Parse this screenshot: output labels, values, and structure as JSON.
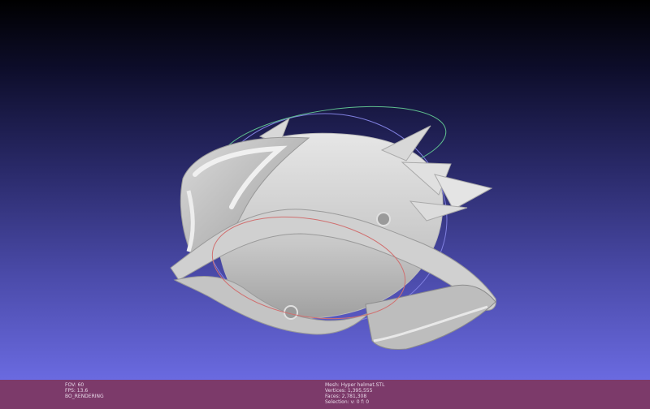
{
  "viewer": {
    "model_name": "helmet mesh"
  },
  "status": {
    "left": [
      "FOV: 60",
      "FPS:    13.6",
      "BO_RENDERING"
    ],
    "right": [
      "Mesh: Hyper helmet.STL",
      "Vertices: 1,395,555",
      "Faces: 2,781,308",
      "Selection: v: 0 f: 0"
    ]
  },
  "colors": {
    "status_bar": "#7c3a6a",
    "model": "#d4d4d4",
    "trackball_green": "#5fbf8f",
    "trackball_red": "#d07070",
    "trackball_blue": "#8080e0"
  }
}
